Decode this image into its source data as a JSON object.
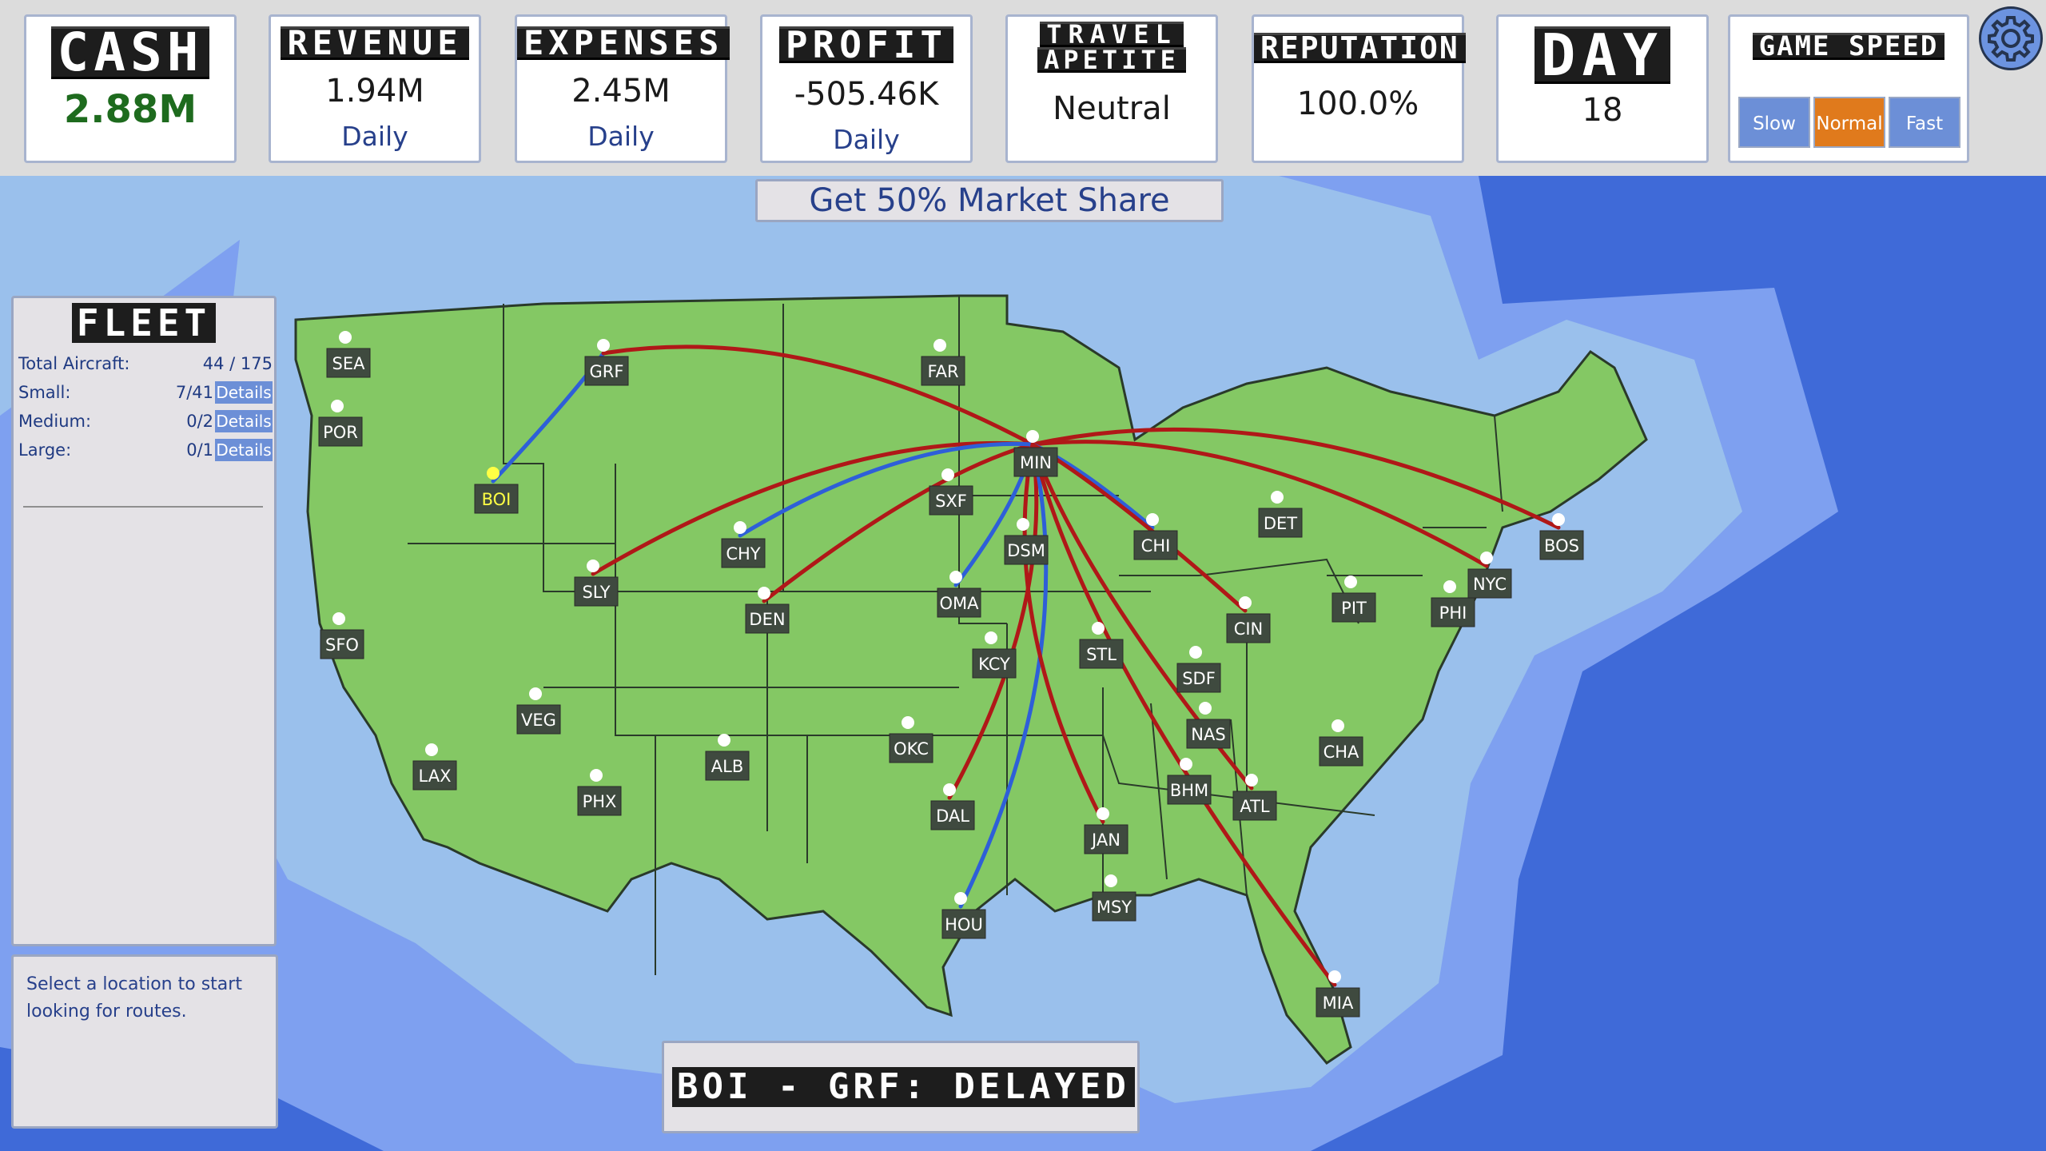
{
  "stats": {
    "cash": {
      "title": "CASH",
      "value": "2.88M"
    },
    "revenue": {
      "title": "REVENUE",
      "value": "1.94M",
      "sub": "Daily"
    },
    "expenses": {
      "title": "EXPENSES",
      "value": "2.45M",
      "sub": "Daily"
    },
    "profit": {
      "title": "PROFIT",
      "value": "-505.46K",
      "sub": "Daily"
    },
    "travel": {
      "title1": "TRAVEL",
      "title2": "APETITE",
      "value": "Neutral"
    },
    "reputation": {
      "title": "REPUTATION",
      "value": "100.0%"
    },
    "day": {
      "title": "DAY",
      "value": "18"
    },
    "speed": {
      "title": "GAME SPEED",
      "slow": "Slow",
      "normal": "Normal",
      "fast": "Fast",
      "selected": "Normal"
    }
  },
  "objective": "Get 50% Market Share",
  "fleet": {
    "title": "FLEET",
    "rows": [
      {
        "label": "Total Aircraft:",
        "value": "44 / 175"
      },
      {
        "label": "Small:",
        "value": "7/41",
        "details": "Details"
      },
      {
        "label": "Medium:",
        "value": "0/2",
        "details": "Details"
      },
      {
        "label": "Large:",
        "value": "0/1",
        "details": "Details"
      }
    ]
  },
  "info_text": [
    "Select a location to start",
    "looking for routes."
  ],
  "status_board": "BOI - GRF: DELAYED",
  "colors": {
    "land": "#84c864",
    "selected": "#ffff44",
    "route_red": "#b01818",
    "route_blue": "#2e5fd8",
    "ocean_deep": "#3f6ad8"
  },
  "cities": [
    {
      "code": "SEA"
    },
    {
      "code": "POR"
    },
    {
      "code": "BOI",
      "selected": true
    },
    {
      "code": "GRF"
    },
    {
      "code": "FAR"
    },
    {
      "code": "MIN"
    },
    {
      "code": "SXF"
    },
    {
      "code": "DSM"
    },
    {
      "code": "CHI"
    },
    {
      "code": "DET"
    },
    {
      "code": "BOS"
    },
    {
      "code": "NYC"
    },
    {
      "code": "PHI"
    },
    {
      "code": "PIT"
    },
    {
      "code": "CIN"
    },
    {
      "code": "CHY"
    },
    {
      "code": "SLY"
    },
    {
      "code": "DEN"
    },
    {
      "code": "OMA"
    },
    {
      "code": "KCY"
    },
    {
      "code": "STL"
    },
    {
      "code": "SDF"
    },
    {
      "code": "NAS"
    },
    {
      "code": "CHA"
    },
    {
      "code": "ATL"
    },
    {
      "code": "BHM"
    },
    {
      "code": "JAN"
    },
    {
      "code": "MSY"
    },
    {
      "code": "MIA"
    },
    {
      "code": "HOU"
    },
    {
      "code": "DAL"
    },
    {
      "code": "OKC"
    },
    {
      "code": "ALB"
    },
    {
      "code": "PHX"
    },
    {
      "code": "VEG"
    },
    {
      "code": "LAX"
    },
    {
      "code": "SFO"
    }
  ],
  "routes": [
    {
      "from": "BOI",
      "to": "GRF",
      "type": "blue"
    },
    {
      "from": "GRF",
      "to": "MIN",
      "type": "red"
    },
    {
      "from": "SLY",
      "to": "MIN",
      "type": "red"
    },
    {
      "from": "DEN",
      "to": "MIN",
      "type": "red"
    },
    {
      "from": "CHY",
      "to": "MIN",
      "type": "blue"
    },
    {
      "from": "MIN",
      "to": "BOS",
      "type": "red"
    },
    {
      "from": "MIN",
      "to": "NYC",
      "type": "red"
    },
    {
      "from": "MIN",
      "to": "CHI",
      "type": "blue"
    },
    {
      "from": "MIN",
      "to": "DAL",
      "type": "red"
    },
    {
      "from": "MIN",
      "to": "HOU",
      "type": "blue"
    },
    {
      "from": "MIN",
      "to": "OMA",
      "type": "blue"
    },
    {
      "from": "MIN",
      "to": "JAN",
      "type": "red"
    },
    {
      "from": "MIN",
      "to": "ATL",
      "type": "red"
    },
    {
      "from": "MIN",
      "to": "MIA",
      "type": "red"
    },
    {
      "from": "MIN",
      "to": "CIN",
      "type": "red"
    }
  ]
}
